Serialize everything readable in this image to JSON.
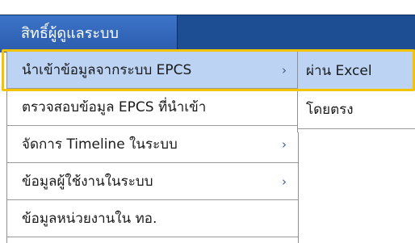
{
  "menubar": {
    "title": "สิทธิ์ผู้ดูแลระบบ"
  },
  "dropdown": {
    "items": [
      {
        "label": "นำเข้าข้อมูลจากระบบ EPCS",
        "arrow": "›"
      },
      {
        "label": "ตรวจสอบข้อมูล EPCS ที่นำเข้า",
        "arrow": ""
      },
      {
        "label": "จัดการ Timeline ในระบบ",
        "arrow": "›"
      },
      {
        "label": "ข้อมูลผู้ใช้งานในระบบ",
        "arrow": "›"
      },
      {
        "label": "ข้อมูลหน่วยงานใน ทอ.",
        "arrow": ""
      }
    ]
  },
  "submenu": {
    "items": [
      {
        "label": "ผ่าน Excel"
      },
      {
        "label": "โดยตรง"
      }
    ]
  },
  "colors": {
    "menubar": "#1d4d93",
    "hover": "#bcd3f3",
    "highlight_frame": "#f3c300"
  }
}
